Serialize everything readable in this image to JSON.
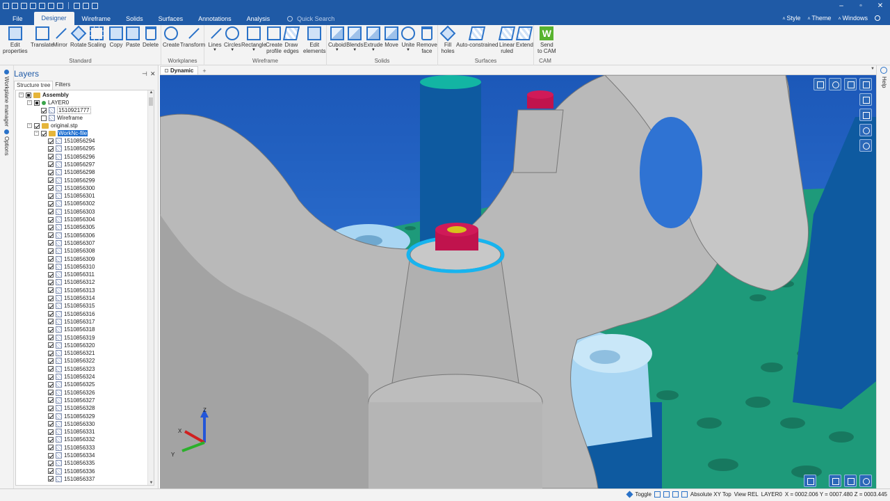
{
  "menu": {
    "items": [
      "File",
      "Designer",
      "Wireframe",
      "Solids",
      "Surfaces",
      "Annotations",
      "Analysis"
    ],
    "active": "Designer",
    "search_placeholder": "Quick Search",
    "right": [
      "Style",
      "Theme",
      "Windows"
    ]
  },
  "window_controls": [
    "–",
    "▫",
    "✕"
  ],
  "ribbon": {
    "groups": {
      "standard": "Standard",
      "workplanes": "Workplanes",
      "wireframe": "Wireframe",
      "solids": "Solids",
      "surfaces": "Surfaces",
      "cam": "CAM"
    },
    "buttons": {
      "edit_properties": "Edit\nproperties",
      "translate": "Translate",
      "mirror": "Mirror",
      "rotate": "Rotate",
      "scaling": "Scaling",
      "copy": "Copy",
      "paste": "Paste",
      "delete": "Delete",
      "create": "Create",
      "transform": "Transform",
      "lines": "Lines",
      "circles": "Circles",
      "rectangle": "Rectangle",
      "create_profile": "Create\nprofile",
      "draw_edges": "Draw\nedges",
      "edit_elements": "Edit\nelements",
      "cuboid": "Cuboid",
      "blends": "Blends",
      "extrude": "Extrude",
      "move": "Move",
      "unite": "Unite",
      "remove_face": "Remove\nface",
      "fill_holes": "Fill\nholes",
      "auto_constrained": "Auto-constrained",
      "linear_ruled": "Linear\nruled",
      "extend": "Extend",
      "send_to_cam": "Send\nto CAM"
    },
    "cam_glyph": "W"
  },
  "layers": {
    "title": "Layers",
    "side_tabs": [
      "Workplane manager",
      "Options"
    ],
    "tabs": [
      "Structure tree",
      "Filters"
    ],
    "tree": {
      "assembly": "Assembly",
      "layer0": "LAYER0",
      "layer0_child": "1510921777",
      "wireframe": "Wireframe",
      "original": "original.stp",
      "workfile": "WorkNc-file",
      "items": [
        "1510856294",
        "1510856295",
        "1510856296",
        "1510856297",
        "1510856298",
        "1510856299",
        "1510856300",
        "1510856301",
        "1510856302",
        "1510856303",
        "1510856304",
        "1510856305",
        "1510856306",
        "1510856307",
        "1510856308",
        "1510856309",
        "1510856310",
        "1510856311",
        "1510856312",
        "1510856313",
        "1510856314",
        "1510856315",
        "1510856316",
        "1510856317",
        "1510856318",
        "1510856319",
        "1510856320",
        "1510856321",
        "1510856322",
        "1510856323",
        "1510856324",
        "1510856325",
        "1510856326",
        "1510856327",
        "1510856328",
        "1510856329",
        "1510856330",
        "1510856331",
        "1510856332",
        "1510856333",
        "1510856334",
        "1510856335",
        "1510856336",
        "1510856337"
      ]
    }
  },
  "document_tab": "Dynamic",
  "help_label": "Help",
  "axes": {
    "z": "Z",
    "x": "X",
    "y": "Y"
  },
  "status": {
    "toggle": "Toggle",
    "view": "Absolute XY Top",
    "view_rel": "View REL",
    "layer": "LAYER0",
    "coords": "X = 0002.006  Y = 0007.480  Z = 0003.445"
  },
  "colors": {
    "accent": "#1f5aa6",
    "table": "#1e9a7a",
    "part": "#b9b9b9",
    "pillar": "#0e5aa0",
    "selection": "#17b4ef"
  }
}
